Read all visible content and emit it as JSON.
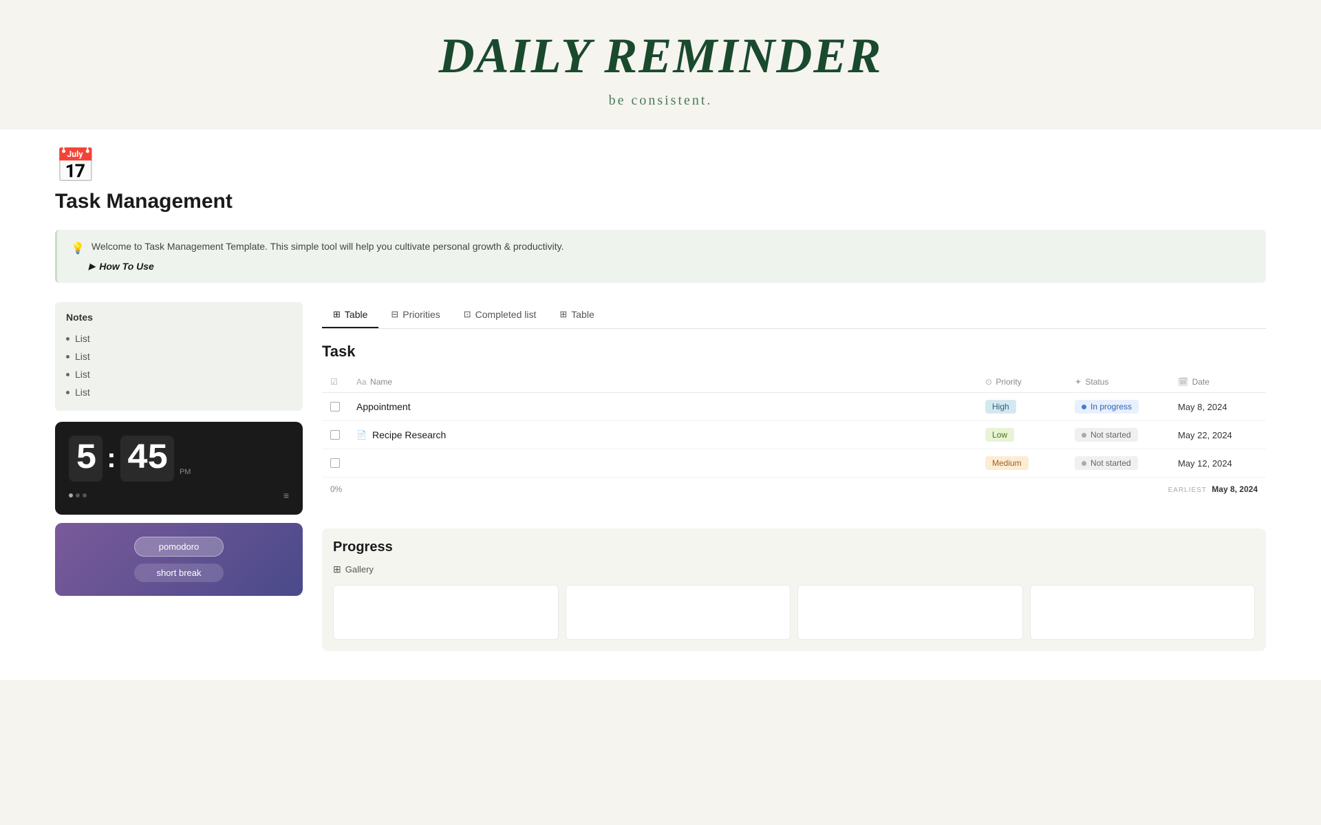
{
  "header": {
    "title": "DAILY REMINDER",
    "subtitle": "be consistent."
  },
  "page": {
    "icon": "📅",
    "title": "Task Management",
    "info_text": "Welcome to Task Management Template. This simple tool will help you cultivate personal growth & productivity.",
    "how_to_use": "How To Use"
  },
  "sidebar": {
    "notes_title": "Notes",
    "list_items": [
      "List",
      "List",
      "List",
      "List"
    ],
    "clock": {
      "hour": "5",
      "minute": "45",
      "period": "PM"
    },
    "pomodoro": {
      "btn1": "pomodoro",
      "btn2": "short break"
    }
  },
  "tabs": [
    {
      "label": "Table",
      "icon": "⊞",
      "active": true
    },
    {
      "label": "Priorities",
      "icon": "⊟"
    },
    {
      "label": "Completed list",
      "icon": "⊡"
    },
    {
      "label": "Table",
      "icon": "⊞"
    }
  ],
  "task_section": {
    "title": "Task",
    "columns": {
      "check": "",
      "name": "Name",
      "priority": "Priority",
      "status": "Status",
      "date": "Date"
    },
    "rows": [
      {
        "name": "Appointment",
        "has_icon": false,
        "priority": "High",
        "priority_class": "high",
        "status": "In progress",
        "status_class": "inprogress",
        "date": "May 8, 2024"
      },
      {
        "name": "Recipe Research",
        "has_icon": true,
        "priority": "Low",
        "priority_class": "low",
        "status": "Not started",
        "status_class": "notstarted",
        "date": "May 22, 2024"
      },
      {
        "name": "",
        "has_icon": false,
        "priority": "Medium",
        "priority_class": "medium",
        "status": "Not started",
        "status_class": "notstarted",
        "date": "May 12, 2024"
      }
    ],
    "footer": {
      "percent": "0%",
      "earliest_label": "EARLIEST",
      "earliest_date": "May 8, 2024"
    }
  },
  "progress_section": {
    "title": "Progress",
    "gallery_label": "Gallery"
  }
}
